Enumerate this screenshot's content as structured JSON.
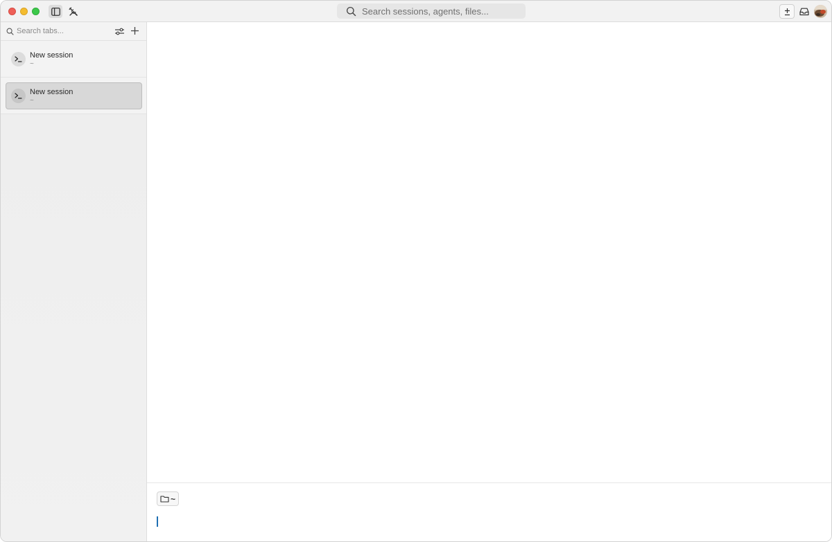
{
  "titlebar": {
    "search_placeholder": "Search sessions, agents, files..."
  },
  "sidebar": {
    "search_placeholder": "Search tabs...",
    "sessions": [
      {
        "title": "New session",
        "path": "~",
        "selected": false
      },
      {
        "title": "New session",
        "path": "~",
        "selected": true
      }
    ]
  },
  "composer": {
    "directory_label": "~"
  },
  "icons": {
    "sidebar_toggle": "sidebar-panel-icon",
    "tools": "tools-icon",
    "search": "search-icon",
    "plus_minus": "plus-minus-icon",
    "inbox": "inbox-icon",
    "filter": "filter-icon",
    "add": "plus-icon",
    "terminal": "terminal-icon",
    "folder": "folder-icon"
  },
  "colors": {
    "accent_cursor": "#1f6fb2",
    "close": "#ee5f57",
    "minimize": "#f4bc2f",
    "maximize": "#3cc84a"
  }
}
